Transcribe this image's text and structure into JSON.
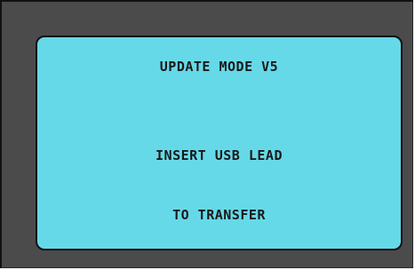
{
  "screen": {
    "line_1": "UPDATE MODE V5",
    "line_2": "INSERT USB LEAD",
    "line_3": "TO TRANSFER"
  },
  "colors": {
    "bezel": "#4b4b4b",
    "lcd_background": "#66d9e8",
    "text": "#1a1a1a"
  }
}
